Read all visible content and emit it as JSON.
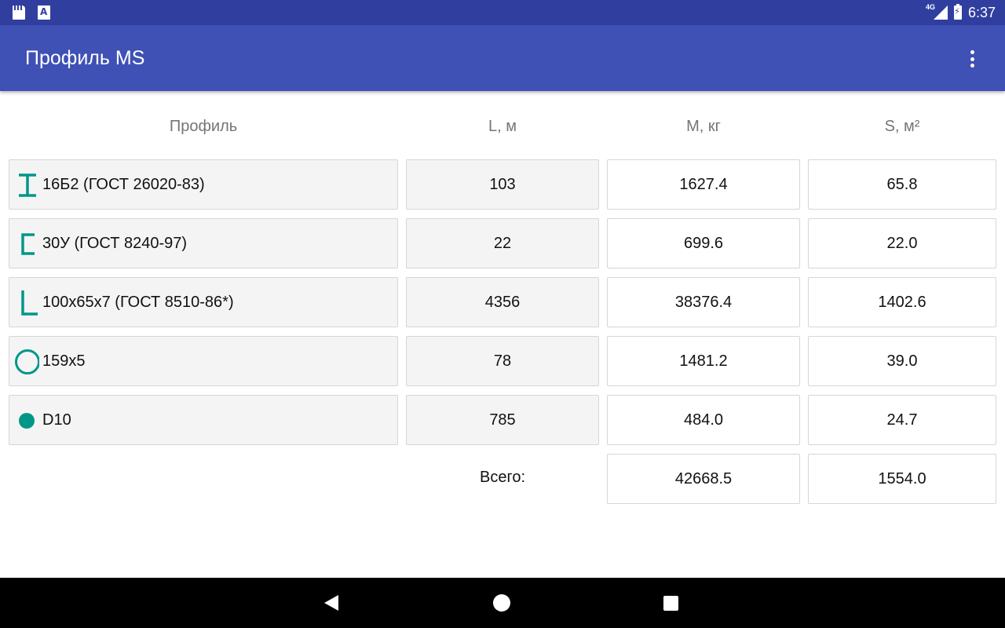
{
  "status_bar": {
    "network_label": "4G",
    "time": "6:37"
  },
  "app_bar": {
    "title": "Профиль MS"
  },
  "table": {
    "headers": {
      "profile": "Профиль",
      "length": "L, м",
      "mass": "M, кг",
      "area": "S, м²"
    },
    "rows": [
      {
        "icon": "i-beam-icon",
        "name": "16Б2 (ГОСТ 26020-83)",
        "length": "103",
        "mass": "1627.4",
        "area": "65.8"
      },
      {
        "icon": "channel-icon",
        "name": "30У (ГОСТ 8240-97)",
        "length": "22",
        "mass": "699.6",
        "area": "22.0"
      },
      {
        "icon": "angle-icon",
        "name": "100x65x7 (ГОСТ 8510-86*)",
        "length": "4356",
        "mass": "38376.4",
        "area": "1402.6"
      },
      {
        "icon": "pipe-icon",
        "name": "159x5",
        "length": "78",
        "mass": "1481.2",
        "area": "39.0"
      },
      {
        "icon": "round-bar-icon",
        "name": "D10",
        "length": "785",
        "mass": "484.0",
        "area": "24.7"
      }
    ],
    "total": {
      "label": "Всего:",
      "mass": "42668.5",
      "area": "1554.0"
    }
  },
  "colors": {
    "status_bar": "#303f9f",
    "app_bar": "#3f51b5",
    "accent_teal": "#009688"
  }
}
